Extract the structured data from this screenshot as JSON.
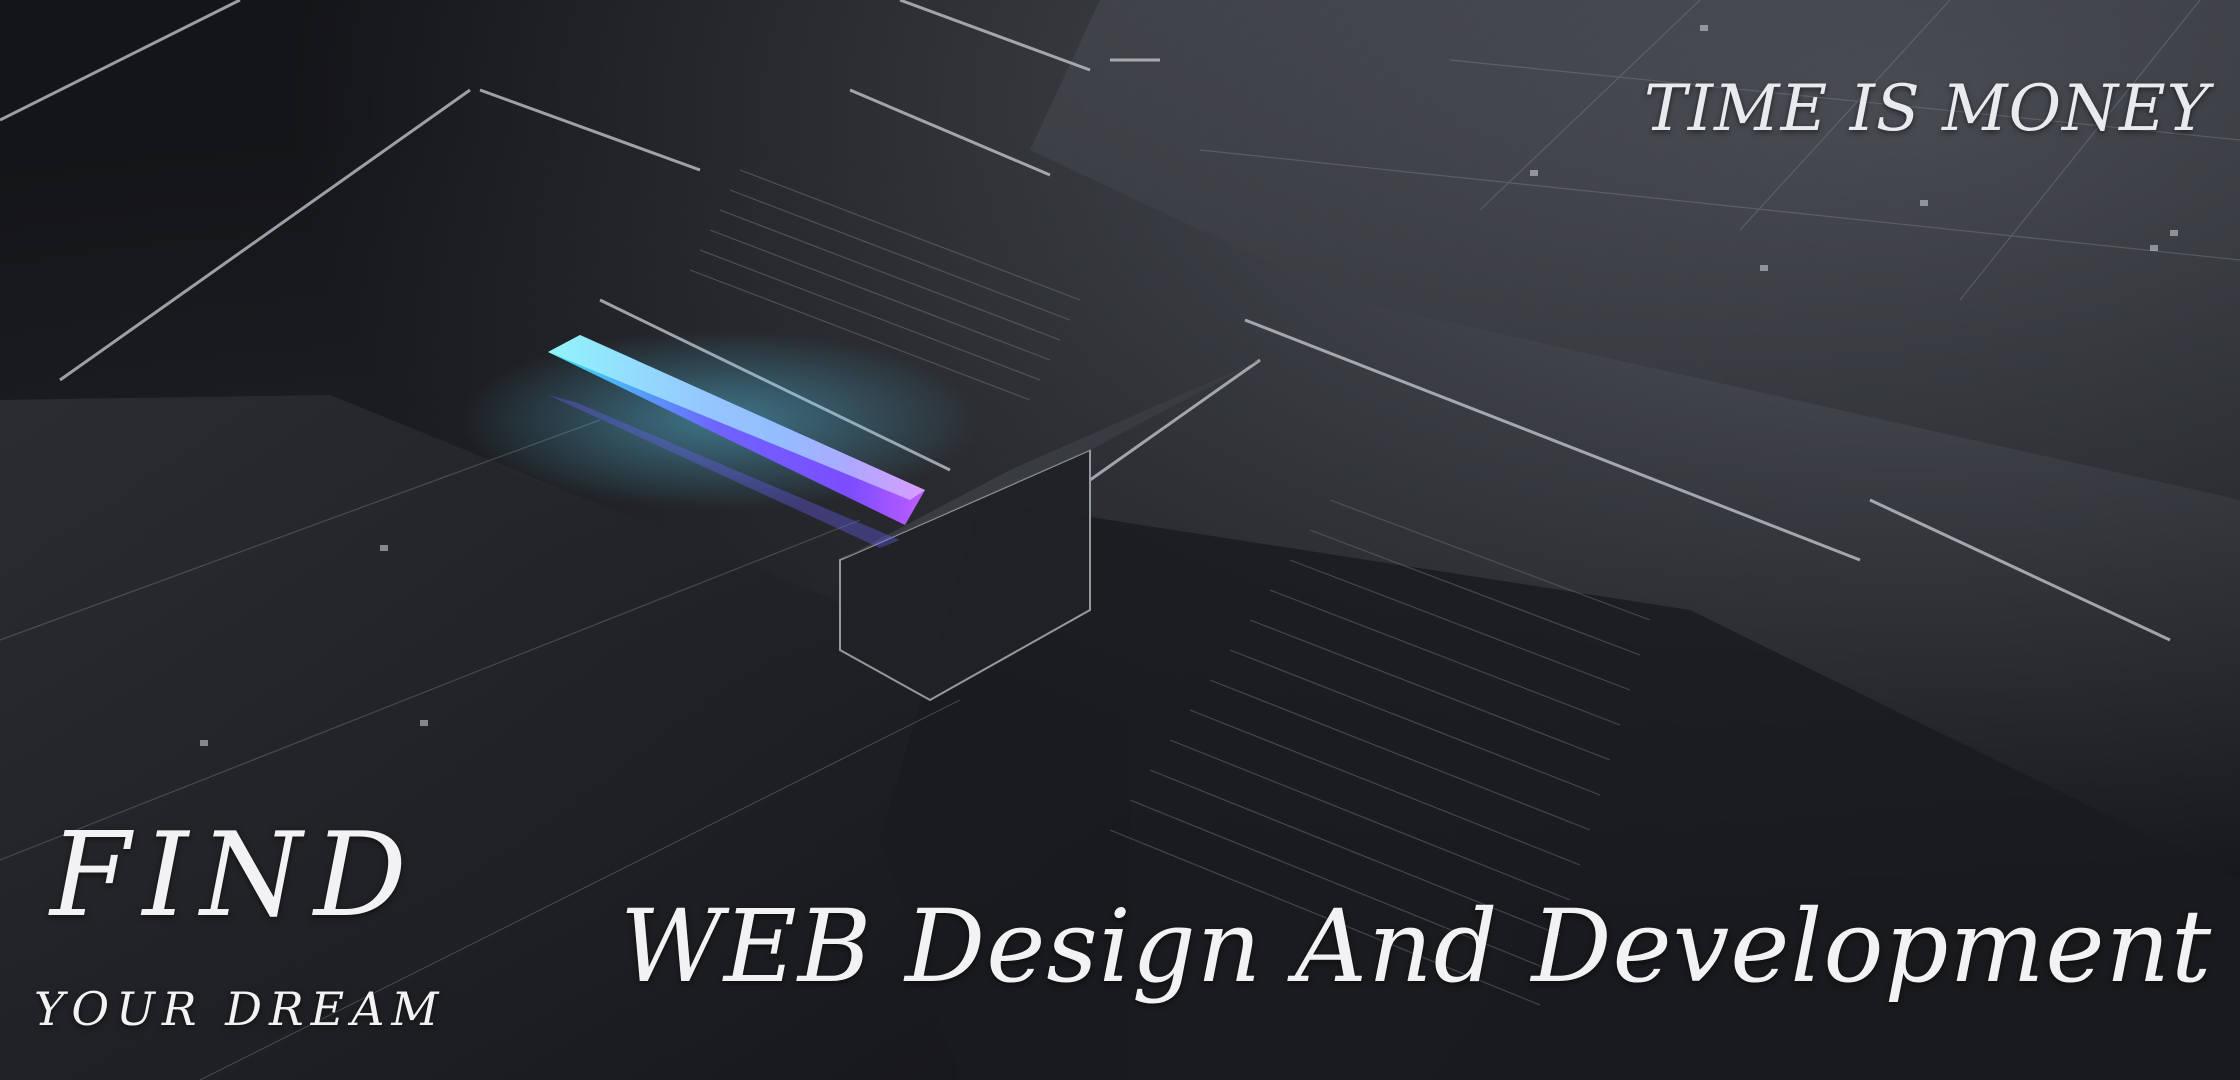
{
  "hero": {
    "tagline_top": "TIME IS MONEY",
    "find": "FIND",
    "your_dream": "YOUR DREAM",
    "title": "WEB Design And Development"
  },
  "colors": {
    "background": "#1c1d20",
    "text": "#f2f2f4",
    "glow_cyan": "#35e6f2",
    "glow_violet": "#7b4dff",
    "glow_magenta": "#c05cff"
  }
}
